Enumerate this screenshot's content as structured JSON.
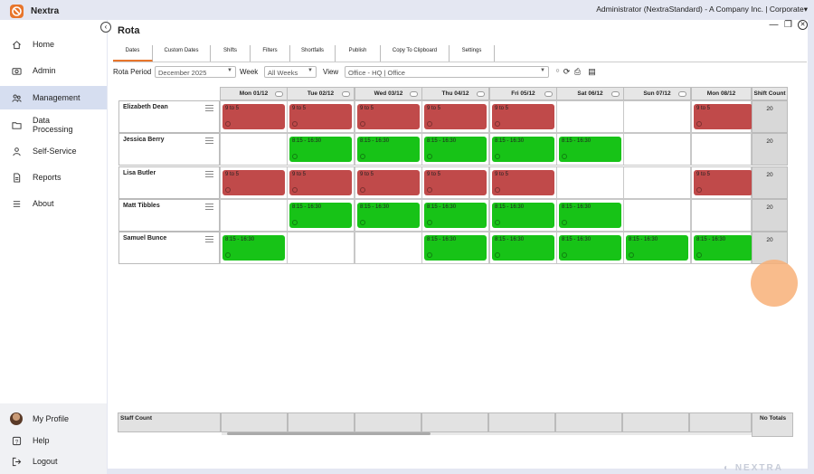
{
  "app": {
    "name": "Nextra",
    "user": "Administrator (NextraStandard) - A Company Inc. | Corporate",
    "accent": "#e8752b"
  },
  "sidebar": {
    "items": [
      {
        "label": "Home",
        "icon": "home-icon",
        "active": false
      },
      {
        "label": "Admin",
        "icon": "camera-icon",
        "active": false
      },
      {
        "label": "Management",
        "icon": "people-icon",
        "active": true
      },
      {
        "label": "Data Processing",
        "icon": "folder-icon",
        "active": false
      },
      {
        "label": "Self-Service",
        "icon": "person-icon",
        "active": false
      },
      {
        "label": "Reports",
        "icon": "document-icon",
        "active": false
      },
      {
        "label": "About",
        "icon": "menu-icon",
        "active": false
      }
    ],
    "bottom": [
      {
        "label": "My Profile",
        "icon": "avatar"
      },
      {
        "label": "Help",
        "icon": "help-icon"
      },
      {
        "label": "Logout",
        "icon": "logout-icon"
      }
    ]
  },
  "page": {
    "title": "Rota"
  },
  "tabs": [
    "Dates",
    "Custom Dates",
    "Shifts",
    "Filters",
    "Shortfalls",
    "Publish",
    "Copy To Clipboard",
    "Settings"
  ],
  "toolbar": {
    "rota_period_label": "Rota Period",
    "rota_period_value": "December 2025",
    "week_label": "Week",
    "week_value": "All Weeks",
    "view_label": "View",
    "view_value": "Office - HQ | Office"
  },
  "grid": {
    "days": [
      "Mon 01/12",
      "Tue 02/12",
      "Wed 03/12",
      "Thu 04/12",
      "Fri 05/12",
      "Sat 06/12",
      "Sun 07/12",
      "Mon 08/12"
    ],
    "shift_count_label": "Shift Count",
    "staff": [
      {
        "name": "Elizabeth Dean",
        "count": "20",
        "shifts": [
          {
            "text": "9 to 5",
            "color": "red"
          },
          {
            "text": "9 to 5",
            "color": "red"
          },
          {
            "text": "9 to 5",
            "color": "red"
          },
          {
            "text": "9 to 5",
            "color": "red"
          },
          {
            "text": "9 to 5",
            "color": "red"
          },
          null,
          null,
          {
            "text": "9 to 5",
            "color": "red"
          }
        ]
      },
      {
        "name": "Jessica Berry",
        "count": "20",
        "shifts": [
          null,
          {
            "text": "8:15 - 16:30",
            "color": "green"
          },
          {
            "text": "8:15 - 16:30",
            "color": "green"
          },
          {
            "text": "8:15 - 16:30",
            "color": "green"
          },
          {
            "text": "8:15 - 16:30",
            "color": "green"
          },
          {
            "text": "8:15 - 16:30",
            "color": "green"
          },
          null,
          null
        ]
      },
      {
        "name": "Lisa Butler",
        "count": "20",
        "shifts": [
          {
            "text": "9 to 5",
            "color": "red"
          },
          {
            "text": "9 to 5",
            "color": "red"
          },
          {
            "text": "9 to 5",
            "color": "red"
          },
          {
            "text": "9 to 5",
            "color": "red"
          },
          {
            "text": "9 to 5",
            "color": "red"
          },
          null,
          null,
          {
            "text": "9 to 5",
            "color": "red"
          }
        ]
      },
      {
        "name": "Matt Tibbles",
        "count": "20",
        "shifts": [
          null,
          {
            "text": "8:15 - 16:30",
            "color": "green"
          },
          {
            "text": "8:15 - 16:30",
            "color": "green"
          },
          {
            "text": "8:15 - 16:30",
            "color": "green"
          },
          {
            "text": "8:15 - 16:30",
            "color": "green"
          },
          {
            "text": "8:15 - 16:30",
            "color": "green"
          },
          null,
          null
        ]
      },
      {
        "name": "Samuel Bunce",
        "count": "20",
        "shifts": [
          {
            "text": "8:15 - 16:30",
            "color": "green"
          },
          null,
          null,
          {
            "text": "8:15 - 16:30",
            "color": "green"
          },
          {
            "text": "8:15 - 16:30",
            "color": "green"
          },
          {
            "text": "8:15 - 16:30",
            "color": "green"
          },
          {
            "text": "8:15 - 16:30",
            "color": "green"
          },
          {
            "text": "8:15 - 16:30",
            "color": "green"
          }
        ]
      }
    ],
    "staff_count_label": "Staff Count",
    "totals_label": "No Totals"
  },
  "colors": {
    "red_shift": "#c04a4a",
    "green_shift": "#17c317",
    "active_nav": "#d6def0"
  }
}
